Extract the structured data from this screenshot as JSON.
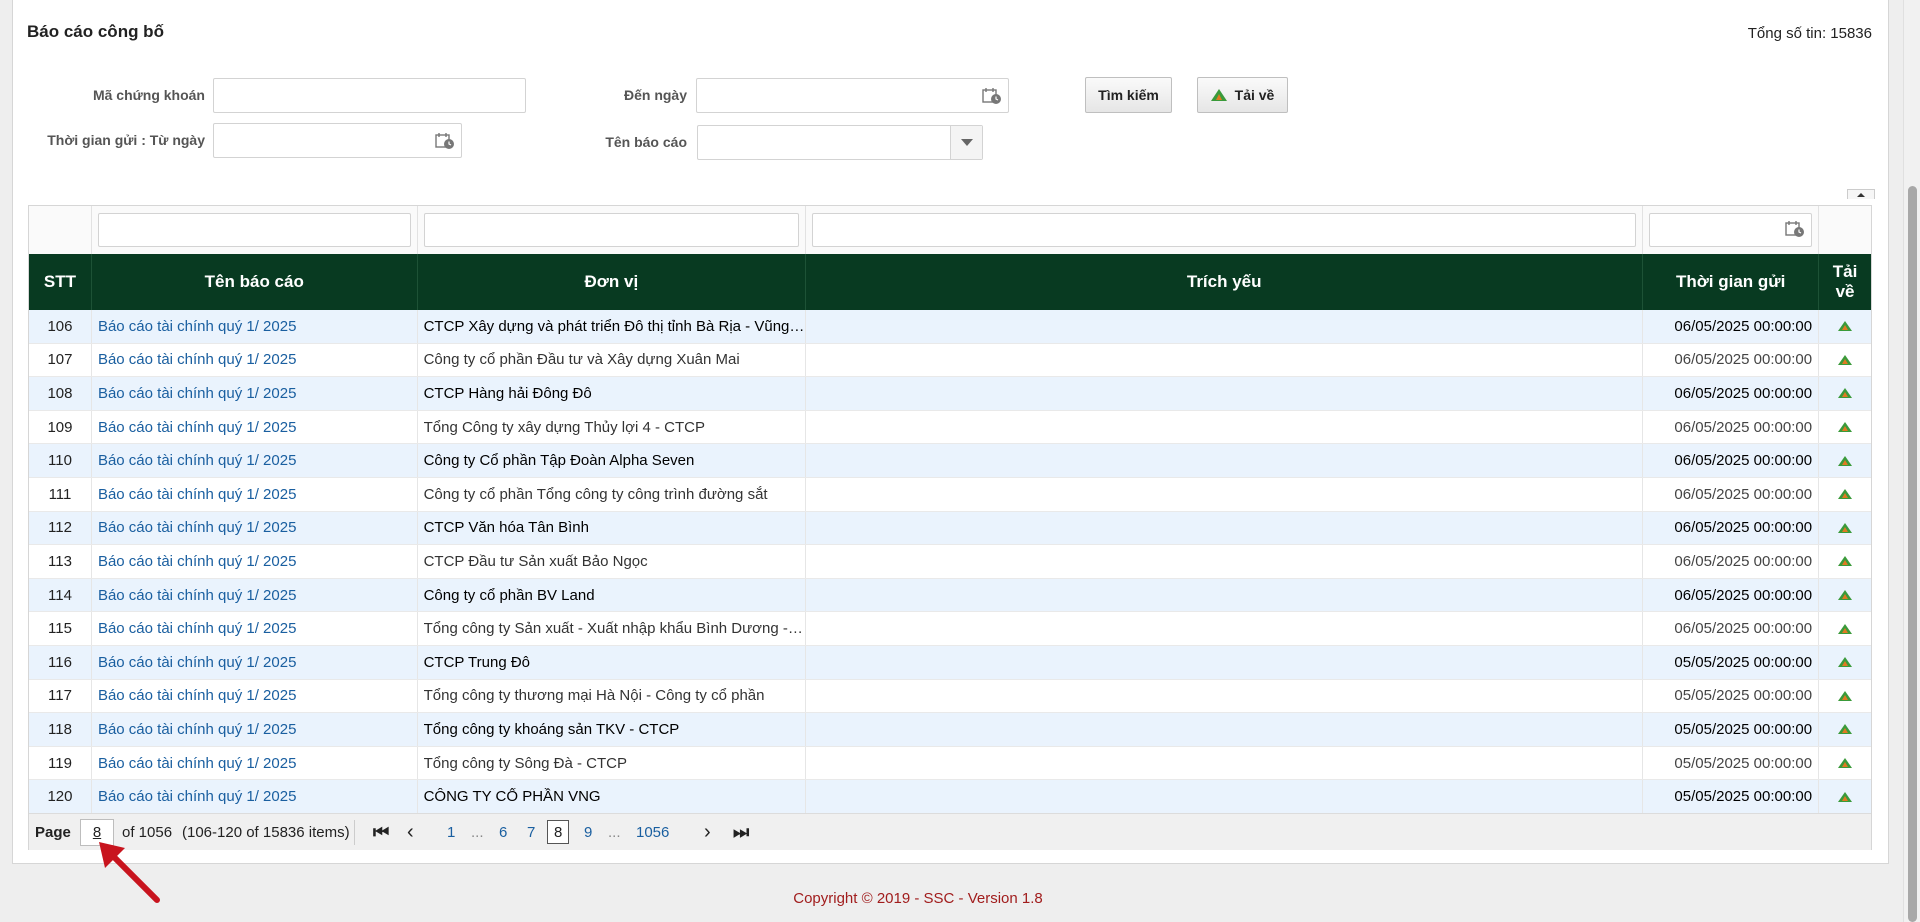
{
  "header": {
    "title": "Báo cáo công bố",
    "total": "Tổng số tin: 15836"
  },
  "filters": {
    "stock_code_label": "Mã chứng khoán",
    "from_date_label": "Thời gian gửi : Từ ngày",
    "to_date_label": "Đến ngày",
    "report_name_label": "Tên báo cáo",
    "search_button": "Tìm kiếm",
    "download_button": "Tải về"
  },
  "table": {
    "columns": [
      "STT",
      "Tên báo cáo",
      "Đơn vị",
      "Trích yếu",
      "Thời gian gửi",
      "Tải về"
    ],
    "rows": [
      {
        "stt": "106",
        "name": "Báo cáo tài chính quý 1/ 2025",
        "unit": "CTCP Xây dựng và phát triển Đô thị tỉnh Bà Rịa - Vũng Tàu",
        "summary": "",
        "time": "06/05/2025 00:00:00"
      },
      {
        "stt": "107",
        "name": "Báo cáo tài chính quý 1/ 2025",
        "unit": "Công ty cổ phần Đầu tư và Xây dựng Xuân Mai",
        "summary": "",
        "time": "06/05/2025 00:00:00"
      },
      {
        "stt": "108",
        "name": "Báo cáo tài chính quý 1/ 2025",
        "unit": "CTCP Hàng hải Đông Đô",
        "summary": "",
        "time": "06/05/2025 00:00:00"
      },
      {
        "stt": "109",
        "name": "Báo cáo tài chính quý 1/ 2025",
        "unit": "Tổng Công ty xây dựng Thủy lợi 4 - CTCP",
        "summary": "",
        "time": "06/05/2025 00:00:00"
      },
      {
        "stt": "110",
        "name": "Báo cáo tài chính quý 1/ 2025",
        "unit": "Công ty Cổ phần Tập Đoàn Alpha Seven",
        "summary": "",
        "time": "06/05/2025 00:00:00"
      },
      {
        "stt": "111",
        "name": "Báo cáo tài chính quý 1/ 2025",
        "unit": "Công ty cổ phần Tổng công ty công trình đường sắt",
        "summary": "",
        "time": "06/05/2025 00:00:00"
      },
      {
        "stt": "112",
        "name": "Báo cáo tài chính quý 1/ 2025",
        "unit": "CTCP Văn hóa Tân Bình",
        "summary": "",
        "time": "06/05/2025 00:00:00"
      },
      {
        "stt": "113",
        "name": "Báo cáo tài chính quý 1/ 2025",
        "unit": "CTCP Đầu tư Sản xuất Bảo Ngọc",
        "summary": "",
        "time": "06/05/2025 00:00:00"
      },
      {
        "stt": "114",
        "name": "Báo cáo tài chính quý 1/ 2025",
        "unit": "Công ty cổ phần BV Land",
        "summary": "",
        "time": "06/05/2025 00:00:00"
      },
      {
        "stt": "115",
        "name": "Báo cáo tài chính quý 1/ 2025",
        "unit": "Tổng công ty Sản xuất - Xuất nhập khẩu Bình Dương - CTCP",
        "summary": "",
        "time": "06/05/2025 00:00:00"
      },
      {
        "stt": "116",
        "name": "Báo cáo tài chính quý 1/ 2025",
        "unit": "CTCP Trung Đô",
        "summary": "",
        "time": "05/05/2025 00:00:00"
      },
      {
        "stt": "117",
        "name": "Báo cáo tài chính quý 1/ 2025",
        "unit": "Tổng công ty thương mại Hà Nội - Công ty cổ phần",
        "summary": "",
        "time": "05/05/2025 00:00:00"
      },
      {
        "stt": "118",
        "name": "Báo cáo tài chính quý 1/ 2025",
        "unit": "Tổng công ty khoáng sản TKV - CTCP",
        "summary": "",
        "time": "05/05/2025 00:00:00"
      },
      {
        "stt": "119",
        "name": "Báo cáo tài chính quý 1/ 2025",
        "unit": "Tổng công ty Sông Đà - CTCP",
        "summary": "",
        "time": "05/05/2025 00:00:00"
      },
      {
        "stt": "120",
        "name": "Báo cáo tài chính quý 1/ 2025",
        "unit": "CÔNG TY CỔ PHẦN VNG",
        "summary": "",
        "time": "05/05/2025 00:00:00"
      }
    ]
  },
  "pager": {
    "page_label": "Page",
    "current": "8",
    "of_text": "of 1056",
    "range_text": "(106-120 of 15836 items)",
    "pages": [
      "1",
      "...",
      "6",
      "7",
      "8",
      "9",
      "...",
      "1056"
    ]
  },
  "footer": {
    "copyright": "Copyright © 2019 - SSC - Version 1.8"
  },
  "colors": {
    "header_bg": "#083a21",
    "link": "#1a5fa0",
    "footer_text": "#a11d1d",
    "alt_row": "#eaf3fd",
    "annotation_arrow": "#c8141e"
  }
}
